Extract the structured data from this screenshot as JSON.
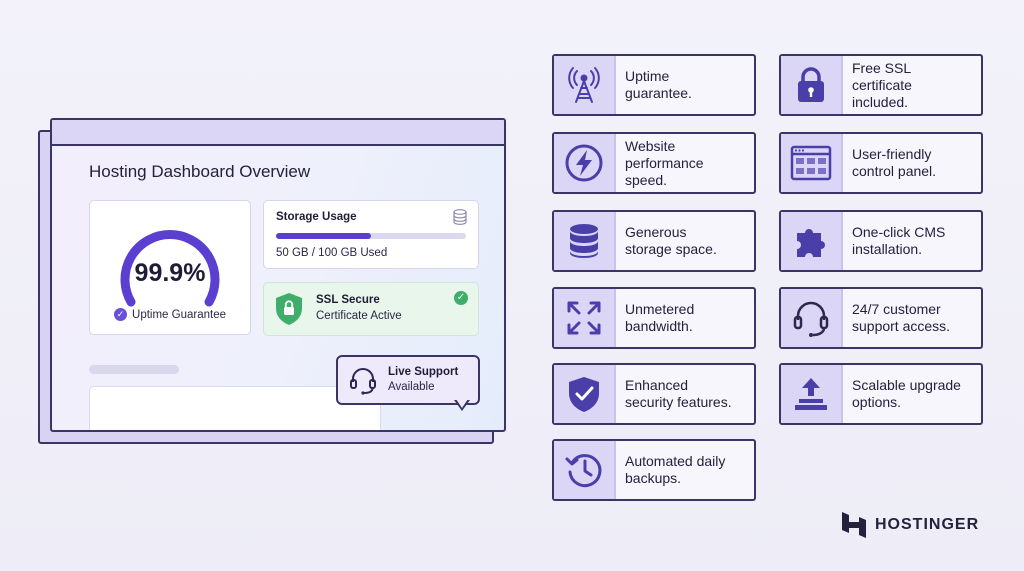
{
  "dashboard": {
    "title": "Hosting Dashboard Overview",
    "uptime": {
      "value": "99.9%",
      "caption": "Uptime Guarantee",
      "fraction": 0.999
    },
    "storage": {
      "title": "Storage Usage",
      "text": "50 GB / 100 GB Used",
      "used_fraction": 0.5
    },
    "ssl": {
      "title": "SSL Secure",
      "subtitle": "Certificate Active"
    },
    "support": {
      "title": "Live Support",
      "subtitle": "Available"
    }
  },
  "features": [
    {
      "id": "uptime",
      "icon": "signal-tower-icon",
      "label": "Uptime\nguarantee."
    },
    {
      "id": "ssl",
      "icon": "padlock-icon",
      "label": "Free SSL\ncertificate\nincluded."
    },
    {
      "id": "speed",
      "icon": "lightning-bolt-icon",
      "label": "Website\nperformance\nspeed."
    },
    {
      "id": "panel",
      "icon": "control-panel-icon",
      "label": "User-friendly\ncontrol panel."
    },
    {
      "id": "storage",
      "icon": "database-icon",
      "label": "Generous\nstorage space."
    },
    {
      "id": "cms",
      "icon": "puzzle-piece-icon",
      "label": "One-click CMS\ninstallation."
    },
    {
      "id": "bandwidth",
      "icon": "expand-arrows-icon",
      "label": "Unmetered\nbandwidth."
    },
    {
      "id": "support",
      "icon": "headset-icon",
      "label": "24/7 customer\nsupport access."
    },
    {
      "id": "security",
      "icon": "shield-check-icon",
      "label": "Enhanced\nsecurity features."
    },
    {
      "id": "upgrade",
      "icon": "upload-arrow-icon",
      "label": "Scalable upgrade\noptions."
    },
    {
      "id": "backups",
      "icon": "history-clock-icon",
      "label": "Automated daily\nbackups."
    }
  ],
  "brand": {
    "name": "HOSTINGER"
  },
  "colors": {
    "accent": "#6b4fd8",
    "icon_bg": "#dcd6f6",
    "outline": "#3b3466",
    "ssl_green": "#3fae6a"
  }
}
